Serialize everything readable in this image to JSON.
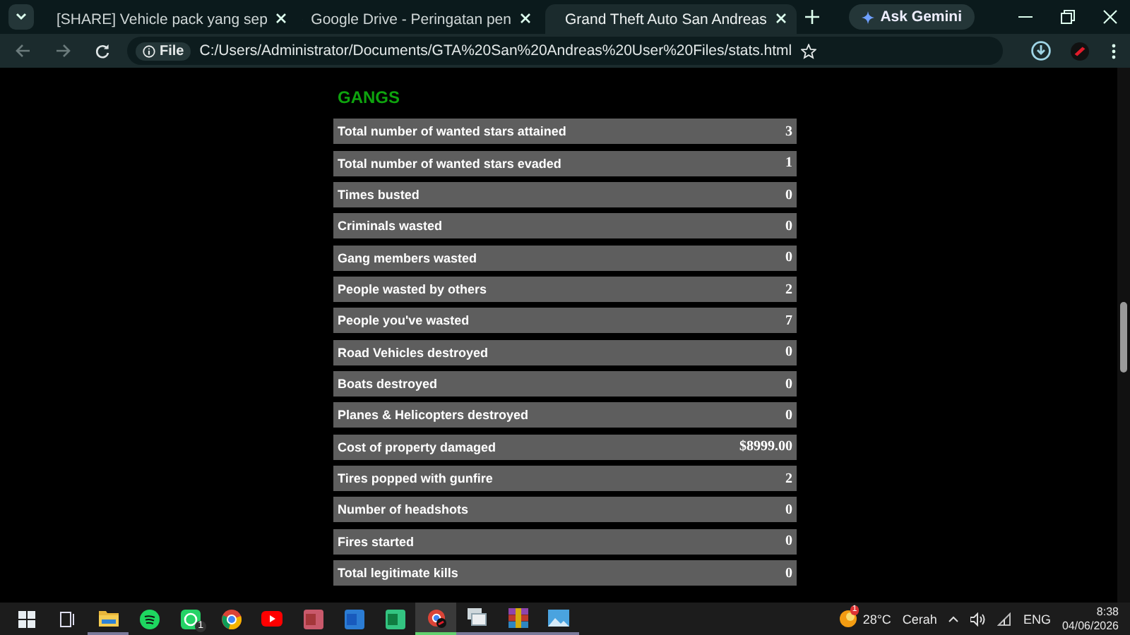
{
  "browser": {
    "tabs": [
      {
        "title": "[SHARE] Vehicle pack yang sep",
        "kind": "sheet",
        "selected": false
      },
      {
        "title": "Google Drive - Peringatan pen",
        "kind": "drive",
        "selected": false
      },
      {
        "title": "Grand Theft Auto San Andreas",
        "kind": "globe",
        "selected": true
      }
    ],
    "gemini_button": "Ask Gemini",
    "scheme_chip": "File",
    "url": "C:/Users/Administrator/Documents/GTA%20San%20Andreas%20User%20Files/stats.html"
  },
  "page": {
    "heading": "GANGS",
    "stats": [
      {
        "label": "Total number of wanted stars attained",
        "value": "3"
      },
      {
        "label": "Total number of wanted stars evaded",
        "value": "1"
      },
      {
        "label": "Times busted",
        "value": "0"
      },
      {
        "label": "Criminals wasted",
        "value": "0"
      },
      {
        "label": "Gang members wasted",
        "value": "0"
      },
      {
        "label": "People wasted by others",
        "value": "2"
      },
      {
        "label": "People you've wasted",
        "value": "7"
      },
      {
        "label": "Road Vehicles destroyed",
        "value": "0"
      },
      {
        "label": "Boats destroyed",
        "value": "0"
      },
      {
        "label": "Planes & Helicopters destroyed",
        "value": "0"
      },
      {
        "label": "Cost of property damaged",
        "value": "$8999.00"
      },
      {
        "label": "Tires popped with gunfire",
        "value": "2"
      },
      {
        "label": "Number of headshots",
        "value": "0"
      },
      {
        "label": "Fires started",
        "value": "0"
      },
      {
        "label": "Total legitimate kills",
        "value": "0"
      }
    ]
  },
  "taskbar": {
    "apps": [
      {
        "kind": "start",
        "open": false,
        "selected": false
      },
      {
        "kind": "taskview",
        "open": false,
        "selected": false
      },
      {
        "kind": "folder",
        "open": true,
        "selected": false
      },
      {
        "kind": "spotify",
        "open": false,
        "selected": false
      },
      {
        "kind": "whatsapp",
        "open": false,
        "selected": false,
        "badge": "1"
      },
      {
        "kind": "chrome",
        "open": false,
        "selected": false
      },
      {
        "kind": "youtube",
        "open": false,
        "selected": false
      },
      {
        "kind": "access",
        "open": false,
        "selected": false
      },
      {
        "kind": "word",
        "open": false,
        "selected": false
      },
      {
        "kind": "excel",
        "open": false,
        "selected": false
      },
      {
        "kind": "chrome-profile",
        "open": true,
        "selected": true
      },
      {
        "kind": "remote",
        "open": true,
        "selected": false
      },
      {
        "kind": "winrar",
        "open": true,
        "selected": false
      },
      {
        "kind": "photos",
        "open": true,
        "selected": false
      }
    ],
    "weather": {
      "badge": "1",
      "temperature": "28°C",
      "condition": "Cerah"
    },
    "language": "ENG",
    "time": "8:38",
    "date": "04/06/2026"
  }
}
